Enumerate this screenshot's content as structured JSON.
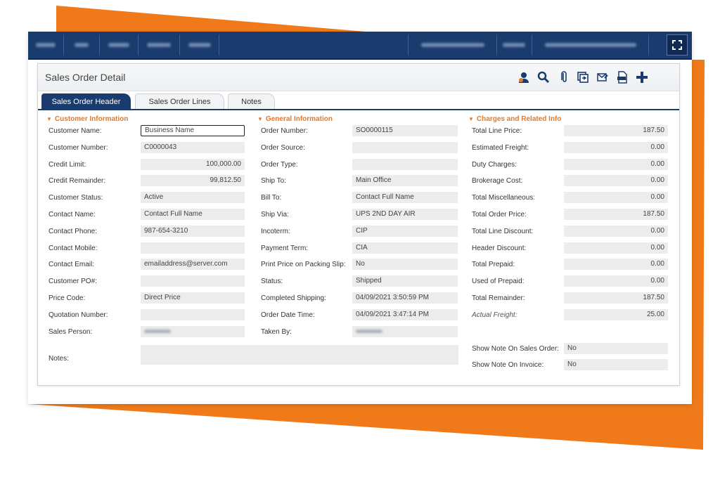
{
  "colors": {
    "accent": "#e87722",
    "brand": "#1a3b6e",
    "field_bg": "#ececec"
  },
  "topbar": {
    "expand_icon": "expand-icon"
  },
  "panel": {
    "title": "Sales Order Detail"
  },
  "toolbar": {
    "icons": [
      "user-lookup-icon",
      "search-icon",
      "attachment-icon",
      "copy-icon",
      "email-icon",
      "pdf-icon",
      "add-icon"
    ]
  },
  "tabs": [
    {
      "label": "Sales Order Header",
      "active": true
    },
    {
      "label": "Sales Order Lines",
      "active": false
    },
    {
      "label": "Notes",
      "active": false
    }
  ],
  "customer": {
    "title": "Customer Information",
    "rows": [
      {
        "label": "Customer Name:",
        "value": "Business Name",
        "align": "left",
        "focus": true
      },
      {
        "label": "Customer Number:",
        "value": "C0000043",
        "align": "left"
      },
      {
        "label": "Credit Limit:",
        "value": "100,000.00",
        "align": "right"
      },
      {
        "label": "Credit Remainder:",
        "value": "99,812.50",
        "align": "right"
      },
      {
        "label": "Customer Status:",
        "value": "Active",
        "align": "left"
      },
      {
        "label": "Contact Name:",
        "value": "Contact Full Name",
        "align": "left"
      },
      {
        "label": "Contact Phone:",
        "value": "987-654-3210",
        "align": "left"
      },
      {
        "label": "Contact Mobile:",
        "value": "",
        "align": "left"
      },
      {
        "label": "Contact Email:",
        "value": "emailaddress@server.com",
        "align": "left"
      },
      {
        "label": "Customer PO#:",
        "value": "",
        "align": "left"
      },
      {
        "label": "Price Code:",
        "value": "Direct Price",
        "align": "left"
      },
      {
        "label": "Quotation Number:",
        "value": "",
        "align": "left"
      },
      {
        "label": "Sales Person:",
        "value": "",
        "align": "left",
        "blurred": true
      }
    ],
    "notes_label": "Notes:",
    "notes_value": ""
  },
  "general": {
    "title": "General Information",
    "rows": [
      {
        "label": "Order Number:",
        "value": "SO0000115"
      },
      {
        "label": "Order Source:",
        "value": ""
      },
      {
        "label": "Order Type:",
        "value": ""
      },
      {
        "label": "Ship To:",
        "value": "Main Office"
      },
      {
        "label": "Bill To:",
        "value": "Contact Full Name"
      },
      {
        "label": "Ship Via:",
        "value": "UPS 2ND DAY AIR"
      },
      {
        "label": "Incoterm:",
        "value": "CIP"
      },
      {
        "label": "Payment Term:",
        "value": "CIA"
      },
      {
        "label": "Print Price on Packing Slip:",
        "value": "No"
      },
      {
        "label": "Status:",
        "value": "Shipped"
      },
      {
        "label": "Completed Shipping:",
        "value": "04/09/2021  3:50:59 PM"
      },
      {
        "label": "Order Date Time:",
        "value": "04/09/2021  3:47:14 PM"
      },
      {
        "label": "Taken By:",
        "value": "",
        "blurred": true
      }
    ]
  },
  "charges": {
    "title": "Charges and Related Info",
    "rows": [
      {
        "label": "Total Line Price:",
        "value": "187.50"
      },
      {
        "label": "Estimated Freight:",
        "value": "0.00"
      },
      {
        "label": "Duty Charges:",
        "value": "0.00"
      },
      {
        "label": "Brokerage Cost:",
        "value": "0.00"
      },
      {
        "label": "Total Miscellaneous:",
        "value": "0.00"
      },
      {
        "label": "Total Order Price:",
        "value": "187.50"
      },
      {
        "label": "Total Line Discount:",
        "value": "0.00"
      },
      {
        "label": "Header Discount:",
        "value": "0.00"
      },
      {
        "label": "Total Prepaid:",
        "value": "0.00"
      },
      {
        "label": "Used of Prepaid:",
        "value": "0.00"
      },
      {
        "label": "Total Remainder:",
        "value": "187.50"
      },
      {
        "label": "Actual Freight:",
        "value": "25.00",
        "italic": true
      }
    ],
    "extra": [
      {
        "label": "Show Note On Sales Order:",
        "value": "No"
      },
      {
        "label": "Show Note On Invoice:",
        "value": "No"
      }
    ]
  }
}
